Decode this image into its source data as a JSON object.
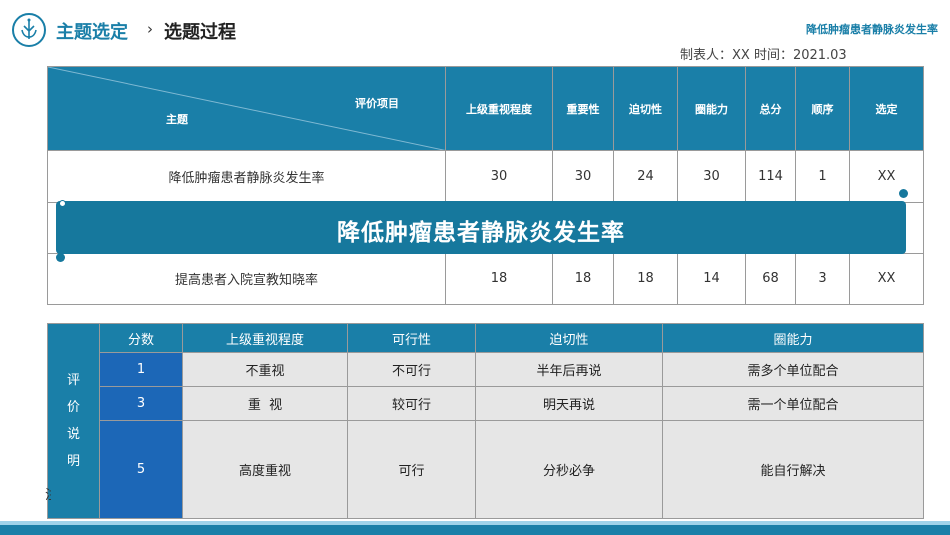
{
  "header": {
    "title": "主题选定",
    "chevron": "›",
    "subtitle": "选题过程",
    "topic": "降低肿瘤患者静脉炎发生率",
    "meta": "制表人：XX    时间：2021.03"
  },
  "table1": {
    "diag_top": "评价项目",
    "diag_bottom": "主题",
    "columns": [
      "上级重视程度",
      "重要性",
      "迫切性",
      "圈能力",
      "总分",
      "顺序",
      "选定"
    ],
    "rows": [
      {
        "name": "降低肿瘤患者静脉炎发生率",
        "values": [
          "30",
          "30",
          "24",
          "30",
          "114",
          "1",
          "XX"
        ]
      },
      {
        "name": "",
        "values": [
          "",
          "",
          "",
          "",
          "",
          "",
          ""
        ]
      },
      {
        "name": "提高患者入院宣教知晓率",
        "values": [
          "18",
          "18",
          "18",
          "14",
          "68",
          "3",
          "XX"
        ]
      }
    ]
  },
  "banner": {
    "text": "降低肿瘤患者静脉炎发生率"
  },
  "table2": {
    "side_label": [
      "评",
      "价",
      "说",
      "明"
    ],
    "columns": [
      "分数",
      "上级重视程度",
      "可行性",
      "迫切性",
      "圈能力"
    ],
    "rows": [
      {
        "score": "1",
        "values": [
          "不重视",
          "不可行",
          "半年后再说",
          "需多个单位配合"
        ]
      },
      {
        "score": "3",
        "values": [
          "重  视",
          "较可行",
          "明天再说",
          "需一个单位配合"
        ]
      },
      {
        "score": "5",
        "values": [
          "高度重视",
          "可行",
          "分秒必争",
          "能自行解决"
        ]
      }
    ]
  },
  "stray_text": "注",
  "colors": {
    "primary": "#1a7fa8",
    "banner": "#16789d",
    "score_cell": "#1c67b7",
    "grey_cell": "#e6e6e6"
  }
}
